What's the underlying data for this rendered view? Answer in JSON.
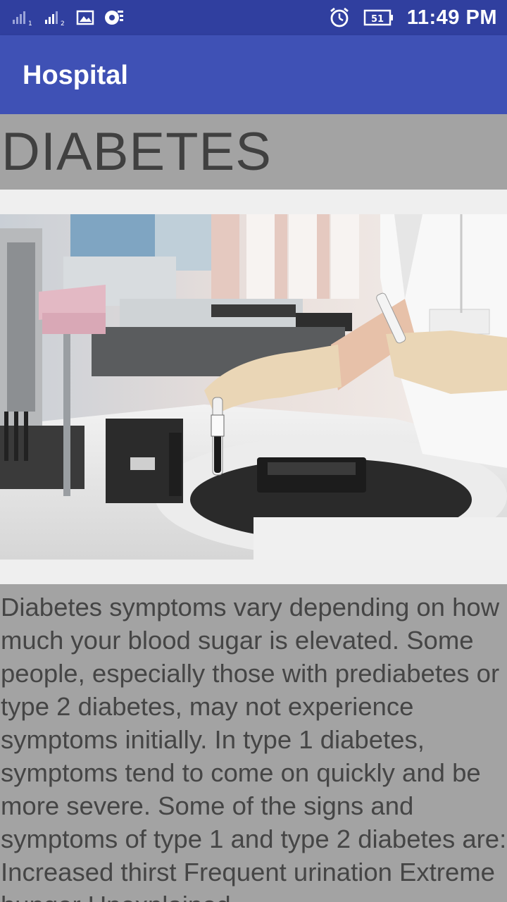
{
  "status_bar": {
    "time": "11:49 PM",
    "battery_level": "51",
    "icons": [
      "signal-sim1-icon",
      "signal-sim2-icon",
      "gallery-icon",
      "sync-icon",
      "alarm-icon",
      "battery-icon"
    ]
  },
  "app_bar": {
    "title": "Hospital"
  },
  "article": {
    "title": "DIABETES",
    "image_alt": "lab-technician-with-blood-sample-icon",
    "body": "Diabetes symptoms vary depending on how much your blood sugar is elevated. Some people, especially those with prediabetes or type 2 diabetes, may not experience symptoms initially. In type 1 diabetes, symptoms tend to come on quickly and be more severe. Some of the signs and symptoms of type 1 and type 2 diabetes are: Increased thirst Frequent urination Extreme hunger Unexplained"
  },
  "colors": {
    "status_bar": "#303f9f",
    "app_bar": "#3f51b5",
    "band_gray": "#a3a3a3",
    "page_bg": "#efefef"
  }
}
